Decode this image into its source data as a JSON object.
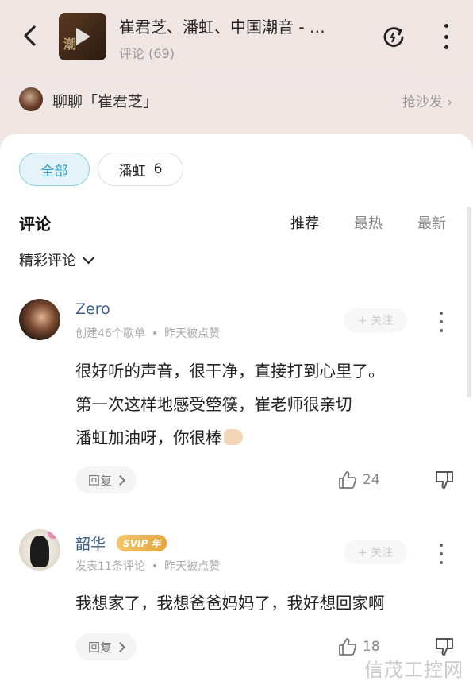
{
  "header": {
    "title": "崔君芝、潘虹、中国潮音 - …",
    "comment_count": "评论 (69)"
  },
  "chat": {
    "label": "聊聊「崔君芝」",
    "action": "抢沙发 ›"
  },
  "filters": {
    "all": "全部",
    "person": "潘虹",
    "person_count": "6"
  },
  "section": {
    "title": "评论",
    "sort_options": [
      "推荐",
      "最热",
      "最新"
    ],
    "active_sort": "推荐",
    "filter_label": "精彩评论"
  },
  "comments": [
    {
      "username": "Zero",
      "meta_left": "创建46个歌单",
      "meta_right": "昨天被点赞",
      "follow": "+ 关注",
      "lines": [
        "很好听的声音，很干净，直接打到心里了。",
        "第一次这样地感受箜篌，崔老师很亲切",
        "潘虹加油呀，你很棒"
      ],
      "reply": "回复",
      "likes": "24"
    },
    {
      "username": "韶华",
      "badge": "SVIP 年",
      "meta_left": "发表11条评论",
      "meta_right": "昨天被点赞",
      "follow": "+ 关注",
      "lines": [
        "我想家了，我想爸爸妈妈了，我好想回家啊"
      ],
      "reply": "回复",
      "likes": "18"
    }
  ],
  "watermark": "信茂工控网",
  "colors": {
    "accent": "#2a9cc4",
    "username": "#3e5e8c",
    "svip_gold": "#e7b454"
  }
}
